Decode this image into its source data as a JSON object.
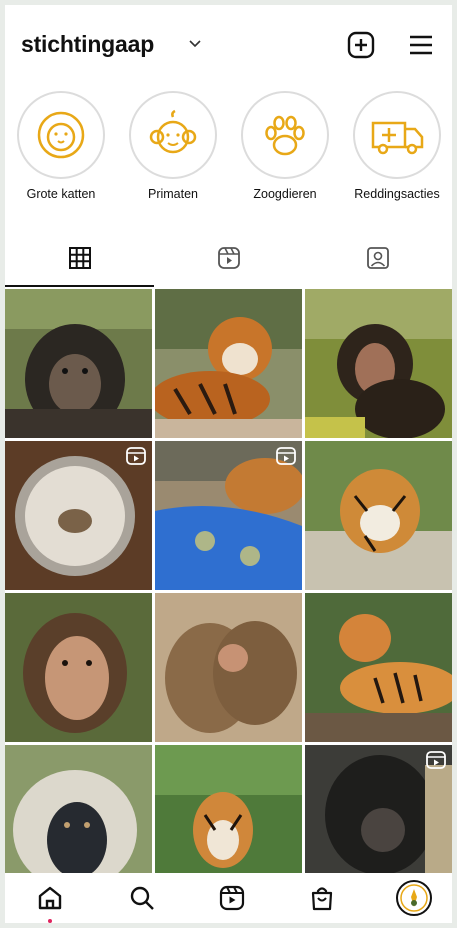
{
  "profile": {
    "username": "stichtingaap"
  },
  "header_icons": [
    "chevron-down-icon",
    "plus-square-icon",
    "menu-icon"
  ],
  "highlights": [
    {
      "label": "Grote katten",
      "icon": "lion-icon"
    },
    {
      "label": "Primaten",
      "icon": "monkey-icon"
    },
    {
      "label": "Zoogdieren",
      "icon": "paw-icon"
    },
    {
      "label": "Reddingsacties",
      "icon": "ambulance-icon"
    }
  ],
  "highlight_color": "#e8a817",
  "tabs": [
    {
      "icon": "grid-icon",
      "active": true
    },
    {
      "icon": "reels-icon",
      "active": false
    },
    {
      "icon": "tagged-icon",
      "active": false
    }
  ],
  "posts": [
    {
      "subject": "chimpanzee",
      "reel": false
    },
    {
      "subject": "tiger",
      "reel": false
    },
    {
      "subject": "chimpanzee",
      "reel": false
    },
    {
      "subject": "bowl with small animal",
      "reel": true
    },
    {
      "subject": "tiger with blue blanket",
      "reel": true
    },
    {
      "subject": "tiger",
      "reel": false
    },
    {
      "subject": "chimpanzee",
      "reel": false
    },
    {
      "subject": "macaques huddling",
      "reel": false
    },
    {
      "subject": "tiger lying",
      "reel": false
    },
    {
      "subject": "vervet monkey",
      "reel": false
    },
    {
      "subject": "tiger",
      "reel": false
    },
    {
      "subject": "chimpanzee",
      "reel": true
    }
  ],
  "bottom_nav": [
    "home-icon",
    "search-icon",
    "reels-icon",
    "shop-icon",
    "profile-avatar"
  ],
  "notification_dot_color": "#e0245e"
}
